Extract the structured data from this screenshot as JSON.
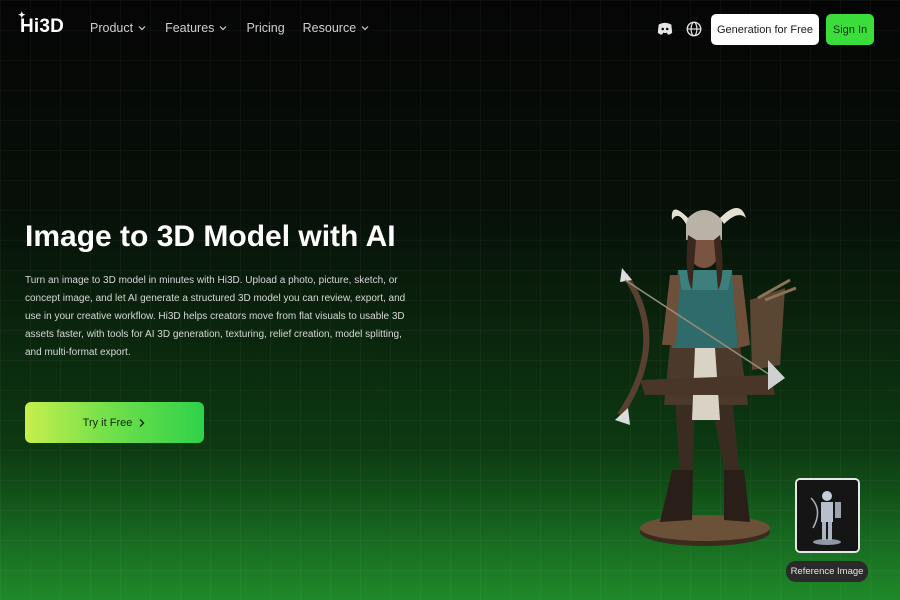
{
  "header": {
    "logo": "Hi3D",
    "nav": [
      {
        "label": "Product",
        "has_dropdown": true
      },
      {
        "label": "Features",
        "has_dropdown": true
      },
      {
        "label": "Pricing",
        "has_dropdown": false
      },
      {
        "label": "Resource",
        "has_dropdown": true
      }
    ],
    "icons": [
      "discord-icon",
      "globe-icon"
    ],
    "generate_button": "Generation for Free",
    "signin_button": "Sign In"
  },
  "hero": {
    "title": "Image to 3D Model with AI",
    "description": "Turn an image to 3D model in minutes with Hi3D. Upload a photo, picture, sketch, or concept image, and let AI generate a structured 3D model you can review, export, and use in your creative workflow. Hi3D helps creators move from flat visuals to usable 3D assets faster, with tools for AI 3D generation, texturing, relief creation, model splitting, and multi-format export.",
    "cta": "Try it Free"
  },
  "showcase": {
    "reference_label": "Reference Image"
  },
  "colors": {
    "accent_green": "#3bdd3b",
    "cta_gradient_start": "#c7ef4d",
    "cta_gradient_end": "#2fd24b",
    "background_top": "#050505",
    "background_bottom": "#1f8a2a"
  }
}
